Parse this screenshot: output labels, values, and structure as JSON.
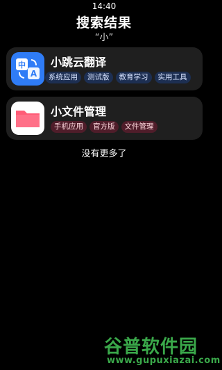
{
  "status_bar": {
    "time": "14:40"
  },
  "header": {
    "title": "搜索结果",
    "query": "“小”"
  },
  "results": [
    {
      "name": "小跳云翻译",
      "icon": "translate-icon",
      "tags": [
        "系统应用",
        "测试版",
        "教育学习",
        "实用工具"
      ]
    },
    {
      "name": "小文件管理",
      "icon": "folder-icon",
      "tags": [
        "手机应用",
        "官方版",
        "文件管理"
      ]
    }
  ],
  "footer": {
    "text": "没有更多了"
  },
  "watermark": {
    "name": "谷普软件园",
    "url": "www.gupuxiazai.com"
  },
  "colors": {
    "background": "#000000",
    "card": "#1f1f1f",
    "tag_blue": "#1d2f52",
    "tag_red": "#4f1d2a",
    "translate_icon": "#2f7cf6",
    "folder_icon": "#ff5c77"
  }
}
